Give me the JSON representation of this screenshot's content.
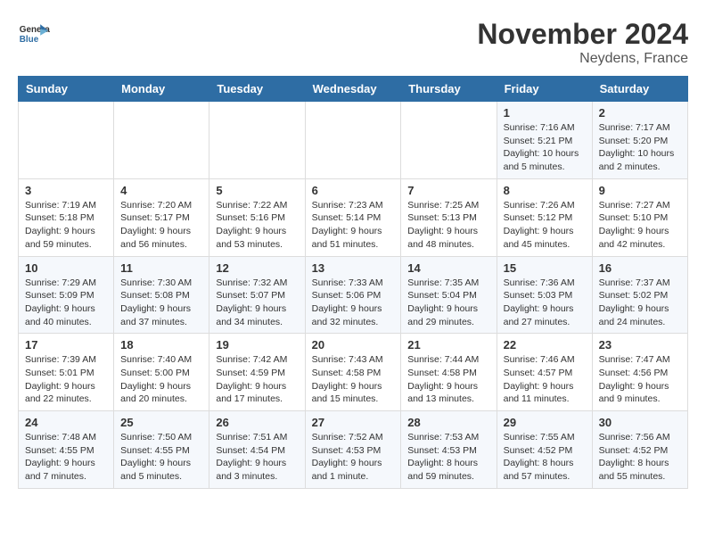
{
  "header": {
    "logo_line1": "General",
    "logo_line2": "Blue",
    "month": "November 2024",
    "location": "Neydens, France"
  },
  "days_of_week": [
    "Sunday",
    "Monday",
    "Tuesday",
    "Wednesday",
    "Thursday",
    "Friday",
    "Saturday"
  ],
  "weeks": [
    [
      {
        "day": "",
        "info": ""
      },
      {
        "day": "",
        "info": ""
      },
      {
        "day": "",
        "info": ""
      },
      {
        "day": "",
        "info": ""
      },
      {
        "day": "",
        "info": ""
      },
      {
        "day": "1",
        "info": "Sunrise: 7:16 AM\nSunset: 5:21 PM\nDaylight: 10 hours\nand 5 minutes."
      },
      {
        "day": "2",
        "info": "Sunrise: 7:17 AM\nSunset: 5:20 PM\nDaylight: 10 hours\nand 2 minutes."
      }
    ],
    [
      {
        "day": "3",
        "info": "Sunrise: 7:19 AM\nSunset: 5:18 PM\nDaylight: 9 hours\nand 59 minutes."
      },
      {
        "day": "4",
        "info": "Sunrise: 7:20 AM\nSunset: 5:17 PM\nDaylight: 9 hours\nand 56 minutes."
      },
      {
        "day": "5",
        "info": "Sunrise: 7:22 AM\nSunset: 5:16 PM\nDaylight: 9 hours\nand 53 minutes."
      },
      {
        "day": "6",
        "info": "Sunrise: 7:23 AM\nSunset: 5:14 PM\nDaylight: 9 hours\nand 51 minutes."
      },
      {
        "day": "7",
        "info": "Sunrise: 7:25 AM\nSunset: 5:13 PM\nDaylight: 9 hours\nand 48 minutes."
      },
      {
        "day": "8",
        "info": "Sunrise: 7:26 AM\nSunset: 5:12 PM\nDaylight: 9 hours\nand 45 minutes."
      },
      {
        "day": "9",
        "info": "Sunrise: 7:27 AM\nSunset: 5:10 PM\nDaylight: 9 hours\nand 42 minutes."
      }
    ],
    [
      {
        "day": "10",
        "info": "Sunrise: 7:29 AM\nSunset: 5:09 PM\nDaylight: 9 hours\nand 40 minutes."
      },
      {
        "day": "11",
        "info": "Sunrise: 7:30 AM\nSunset: 5:08 PM\nDaylight: 9 hours\nand 37 minutes."
      },
      {
        "day": "12",
        "info": "Sunrise: 7:32 AM\nSunset: 5:07 PM\nDaylight: 9 hours\nand 34 minutes."
      },
      {
        "day": "13",
        "info": "Sunrise: 7:33 AM\nSunset: 5:06 PM\nDaylight: 9 hours\nand 32 minutes."
      },
      {
        "day": "14",
        "info": "Sunrise: 7:35 AM\nSunset: 5:04 PM\nDaylight: 9 hours\nand 29 minutes."
      },
      {
        "day": "15",
        "info": "Sunrise: 7:36 AM\nSunset: 5:03 PM\nDaylight: 9 hours\nand 27 minutes."
      },
      {
        "day": "16",
        "info": "Sunrise: 7:37 AM\nSunset: 5:02 PM\nDaylight: 9 hours\nand 24 minutes."
      }
    ],
    [
      {
        "day": "17",
        "info": "Sunrise: 7:39 AM\nSunset: 5:01 PM\nDaylight: 9 hours\nand 22 minutes."
      },
      {
        "day": "18",
        "info": "Sunrise: 7:40 AM\nSunset: 5:00 PM\nDaylight: 9 hours\nand 20 minutes."
      },
      {
        "day": "19",
        "info": "Sunrise: 7:42 AM\nSunset: 4:59 PM\nDaylight: 9 hours\nand 17 minutes."
      },
      {
        "day": "20",
        "info": "Sunrise: 7:43 AM\nSunset: 4:58 PM\nDaylight: 9 hours\nand 15 minutes."
      },
      {
        "day": "21",
        "info": "Sunrise: 7:44 AM\nSunset: 4:58 PM\nDaylight: 9 hours\nand 13 minutes."
      },
      {
        "day": "22",
        "info": "Sunrise: 7:46 AM\nSunset: 4:57 PM\nDaylight: 9 hours\nand 11 minutes."
      },
      {
        "day": "23",
        "info": "Sunrise: 7:47 AM\nSunset: 4:56 PM\nDaylight: 9 hours\nand 9 minutes."
      }
    ],
    [
      {
        "day": "24",
        "info": "Sunrise: 7:48 AM\nSunset: 4:55 PM\nDaylight: 9 hours\nand 7 minutes."
      },
      {
        "day": "25",
        "info": "Sunrise: 7:50 AM\nSunset: 4:55 PM\nDaylight: 9 hours\nand 5 minutes."
      },
      {
        "day": "26",
        "info": "Sunrise: 7:51 AM\nSunset: 4:54 PM\nDaylight: 9 hours\nand 3 minutes."
      },
      {
        "day": "27",
        "info": "Sunrise: 7:52 AM\nSunset: 4:53 PM\nDaylight: 9 hours\nand 1 minute."
      },
      {
        "day": "28",
        "info": "Sunrise: 7:53 AM\nSunset: 4:53 PM\nDaylight: 8 hours\nand 59 minutes."
      },
      {
        "day": "29",
        "info": "Sunrise: 7:55 AM\nSunset: 4:52 PM\nDaylight: 8 hours\nand 57 minutes."
      },
      {
        "day": "30",
        "info": "Sunrise: 7:56 AM\nSunset: 4:52 PM\nDaylight: 8 hours\nand 55 minutes."
      }
    ]
  ]
}
